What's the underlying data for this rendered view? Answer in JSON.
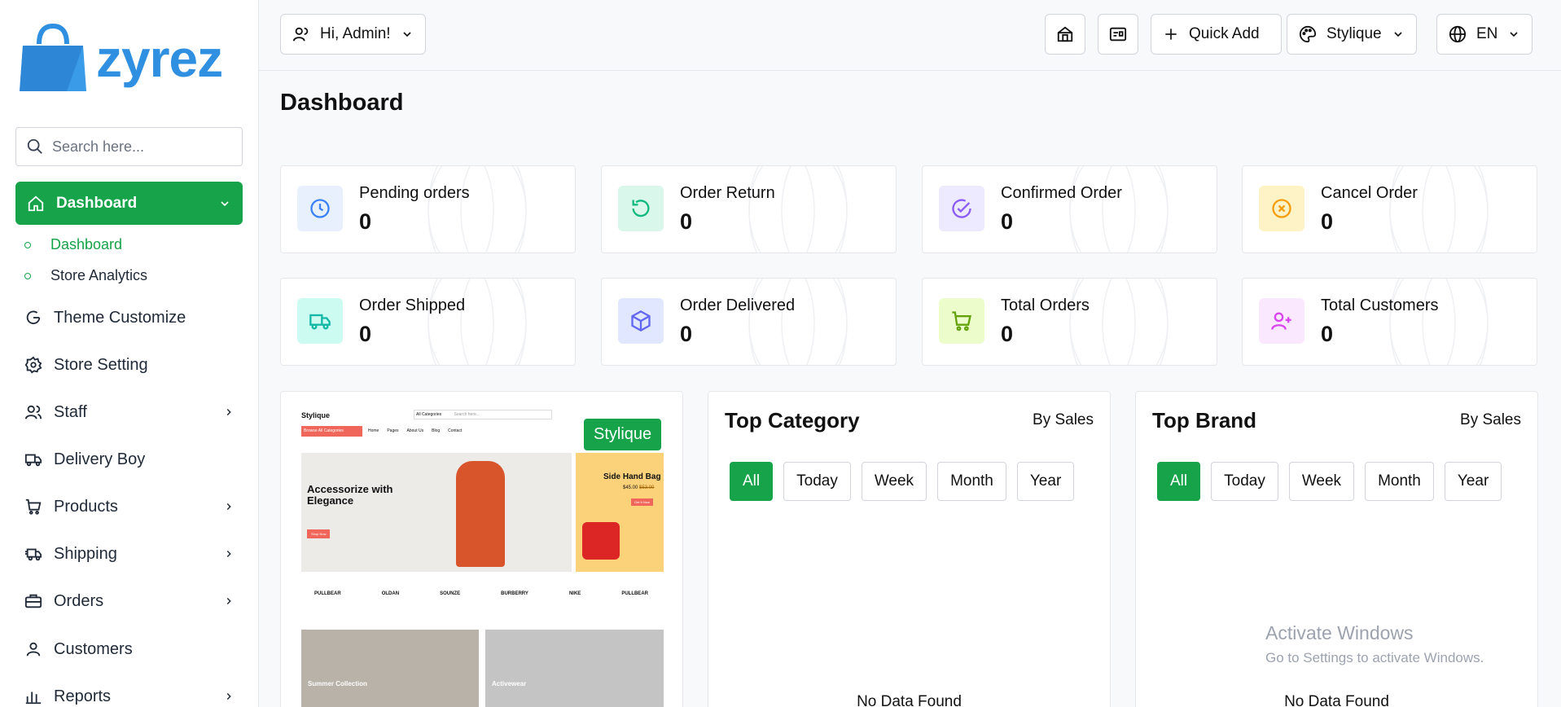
{
  "brand": {
    "name": "zyrez",
    "color": "#2f8fe0"
  },
  "sidebar": {
    "search_placeholder": "Search here...",
    "active_menu": "Dashboard",
    "subitems": [
      {
        "label": "Dashboard"
      },
      {
        "label": "Store Analytics"
      }
    ],
    "items": [
      {
        "label": "Theme Customize",
        "icon": "refresh-g-icon"
      },
      {
        "label": "Store Setting",
        "icon": "gear-icon"
      },
      {
        "label": "Staff",
        "icon": "users-icon"
      },
      {
        "label": "Delivery Boy",
        "icon": "truck-icon"
      },
      {
        "label": "Products",
        "icon": "cart-icon"
      },
      {
        "label": "Shipping",
        "icon": "shipping-truck-icon"
      },
      {
        "label": "Orders",
        "icon": "briefcase-icon"
      },
      {
        "label": "Customers",
        "icon": "user-icon"
      },
      {
        "label": "Reports",
        "icon": "bar-chart-icon"
      }
    ]
  },
  "topbar": {
    "greeting": "Hi, Admin!",
    "quick_add": "Quick Add",
    "theme": "Stylique",
    "language": "EN"
  },
  "page_title": "Dashboard",
  "stats": [
    {
      "label": "Pending orders",
      "value": "0",
      "color": "#3b82f6",
      "bg": "#e8f0fe",
      "icon": "clock-icon"
    },
    {
      "label": "Order Return",
      "value": "0",
      "color": "#10b981",
      "bg": "#d9f7ea",
      "icon": "undo-icon"
    },
    {
      "label": "Confirmed Order",
      "value": "0",
      "color": "#8b5cf6",
      "bg": "#ede9fe",
      "icon": "check-circle-icon"
    },
    {
      "label": "Cancel Order",
      "value": "0",
      "color": "#f59e0b",
      "bg": "#fef3c7",
      "icon": "x-circle-icon"
    },
    {
      "label": "Order Shipped",
      "value": "0",
      "color": "#14b8a6",
      "bg": "#ccfbf1",
      "icon": "truck-icon"
    },
    {
      "label": "Order Delivered",
      "value": "0",
      "color": "#6366f1",
      "bg": "#e0e7ff",
      "icon": "box-icon"
    },
    {
      "label": "Total Orders",
      "value": "0",
      "color": "#65a30d",
      "bg": "#ecfccb",
      "icon": "cart-icon"
    },
    {
      "label": "Total Customers",
      "value": "0",
      "color": "#d946ef",
      "bg": "#fae8ff",
      "icon": "user-plus-icon"
    }
  ],
  "theme_preview": {
    "badge": "Stylique",
    "logo": "Stylique",
    "categories_button": "Browse All Categories",
    "search_category": "All Categories",
    "search_placeholder": "Search here...",
    "menu": [
      "Home",
      "Pages",
      "About Us",
      "Blog",
      "Contact"
    ],
    "hero_title": "Accessorize with Elegance",
    "hero_button": "Shop Now",
    "side_title": "Side Hand Bag",
    "side_price": "$45.00",
    "side_old_price": "$53.00",
    "side_button": "Get It Now",
    "brands": [
      "PULLBEAR",
      "OLDAN",
      "SOUNZE",
      "BURBERRY",
      "NIKE",
      "PULLBEAR"
    ],
    "cards": [
      "Summer Collection",
      "Activewear"
    ]
  },
  "top_category": {
    "title": "Top Category",
    "subtitle": "By Sales",
    "filters": [
      "All",
      "Today",
      "Week",
      "Month",
      "Year"
    ],
    "active_filter": "All",
    "empty": "No Data Found"
  },
  "top_brand": {
    "title": "Top Brand",
    "subtitle": "By Sales",
    "filters": [
      "All",
      "Today",
      "Week",
      "Month",
      "Year"
    ],
    "active_filter": "All",
    "empty": "No Data Found"
  },
  "watermark": {
    "title": "Activate Windows",
    "subtitle": "Go to Settings to activate Windows."
  }
}
